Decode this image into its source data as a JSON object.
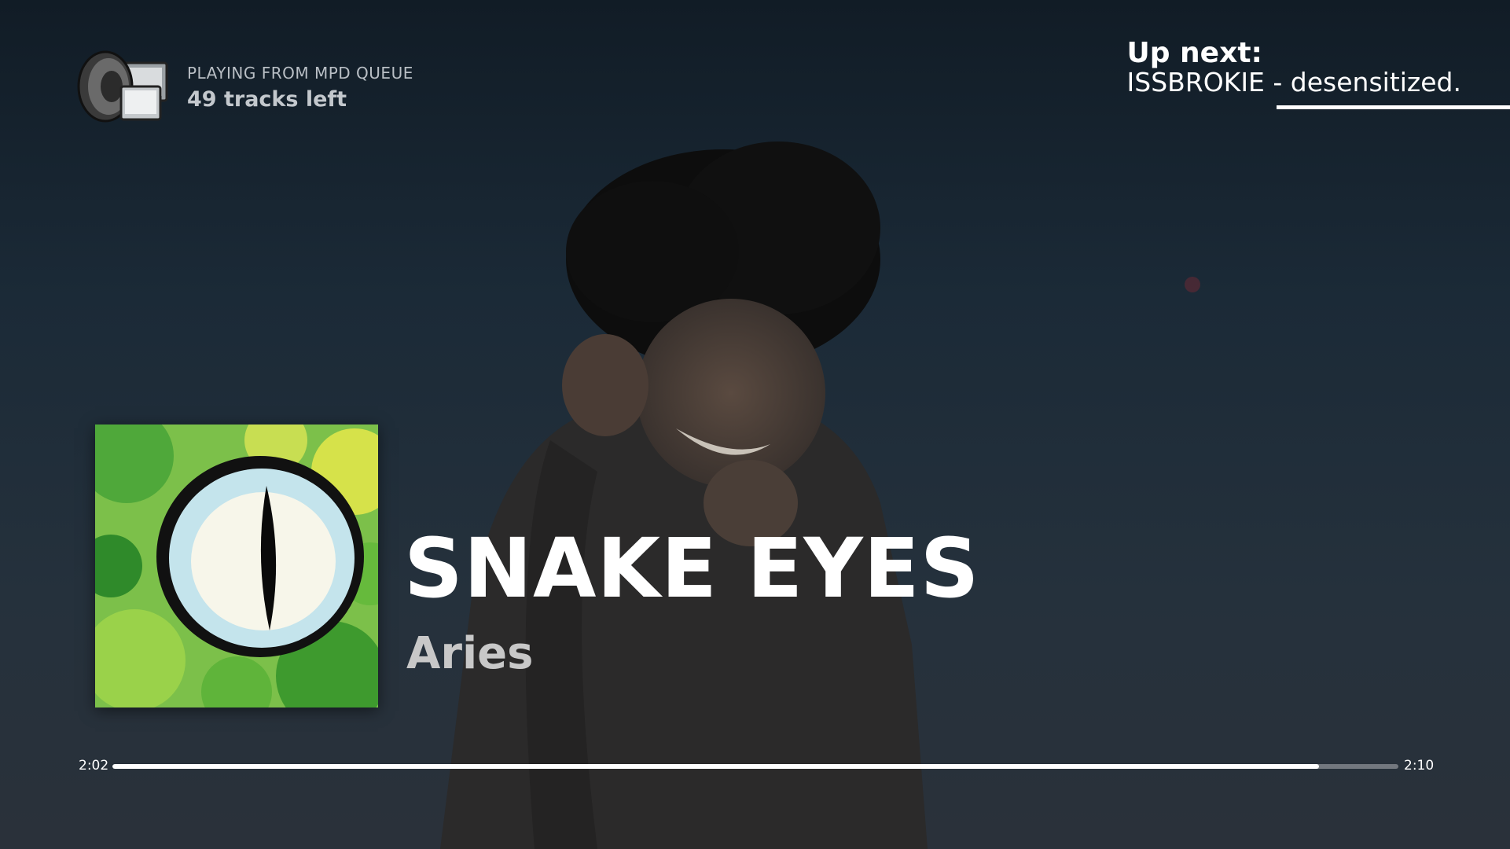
{
  "source": {
    "icon": "speaker-monitor-icon",
    "label": "PLAYING FROM MPD QUEUE",
    "tracks_left": "49 tracks left"
  },
  "up_next": {
    "label": "Up next:",
    "track": "ISSBROKIE - desensitized."
  },
  "now_playing": {
    "title": "SNAKE EYES",
    "artist": "Aries",
    "album_art": "green-reptile-eye-artwork"
  },
  "progress": {
    "elapsed": "2:02",
    "duration": "2:10",
    "fraction": 0.938
  },
  "colors": {
    "accent": "#ffffff",
    "background": "#1b2a37"
  }
}
